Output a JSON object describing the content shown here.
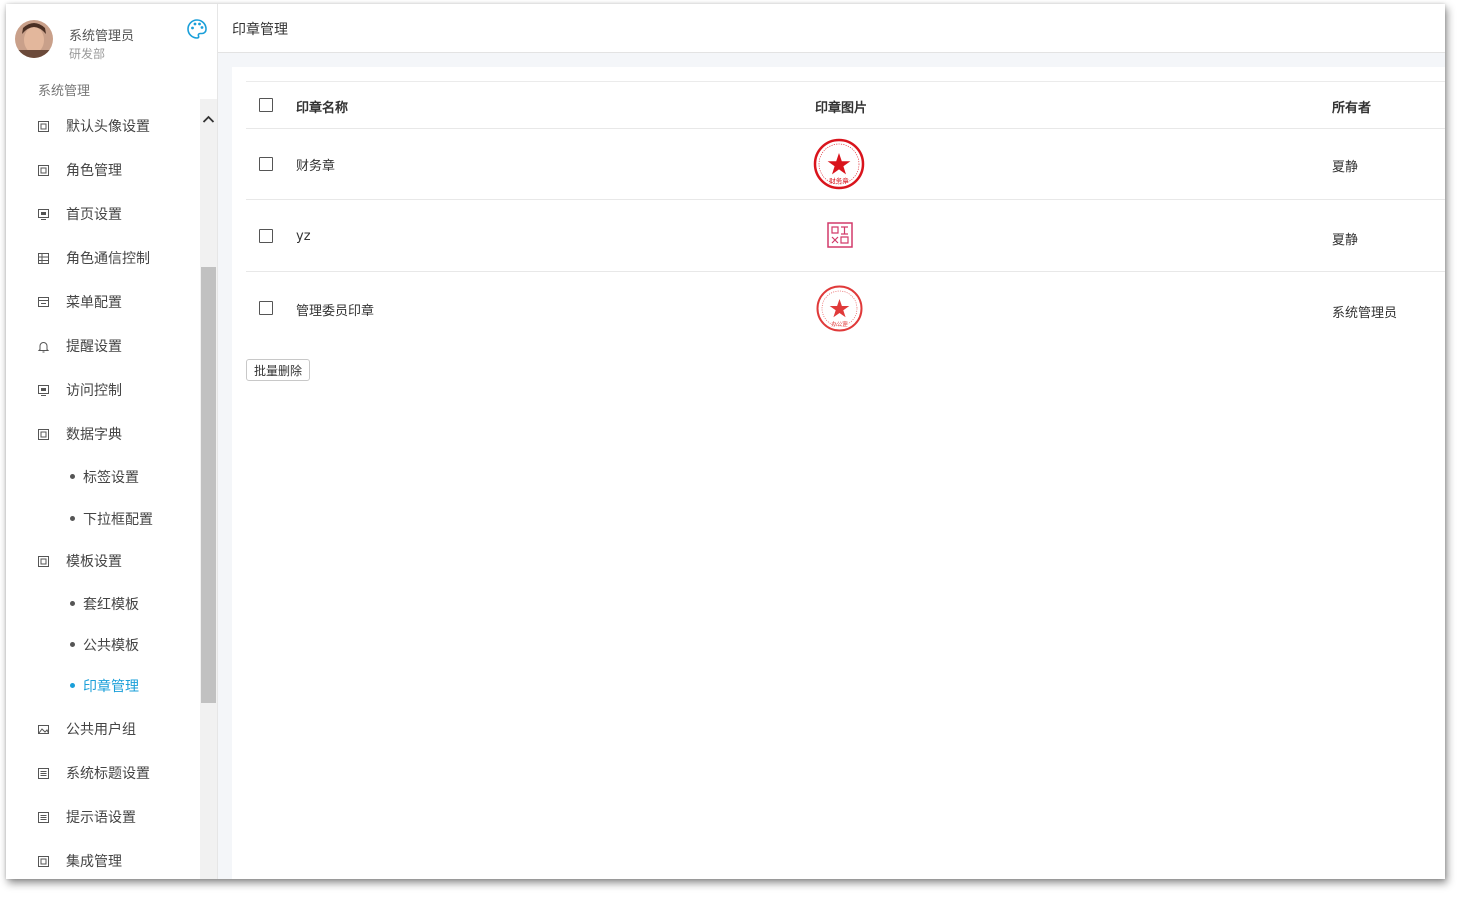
{
  "user": {
    "name": "系统管理员",
    "dept": "研发部"
  },
  "sidebar": {
    "section_title": "系统管理",
    "items": [
      {
        "label": "默认头像设置",
        "icon": "grid-icon"
      },
      {
        "label": "角色管理",
        "icon": "grid-icon"
      },
      {
        "label": "首页设置",
        "icon": "monitor-icon"
      },
      {
        "label": "角色通信控制",
        "icon": "table-icon"
      },
      {
        "label": "菜单配置",
        "icon": "window-icon"
      },
      {
        "label": "提醒设置",
        "icon": "bell-icon"
      },
      {
        "label": "访问控制",
        "icon": "monitor-icon"
      },
      {
        "label": "数据字典",
        "icon": "grid-icon"
      },
      {
        "label": "标签设置",
        "sub": true
      },
      {
        "label": "下拉框配置",
        "sub": true
      },
      {
        "label": "模板设置",
        "icon": "grid-icon"
      },
      {
        "label": "套红模板",
        "sub": true
      },
      {
        "label": "公共模板",
        "sub": true
      },
      {
        "label": "印章管理",
        "sub": true,
        "active": true
      },
      {
        "label": "公共用户组",
        "icon": "image-icon"
      },
      {
        "label": "系统标题设置",
        "icon": "list-icon"
      },
      {
        "label": "提示语设置",
        "icon": "list-icon"
      },
      {
        "label": "集成管理",
        "icon": "grid-icon"
      }
    ]
  },
  "page": {
    "title": "印章管理"
  },
  "table": {
    "columns": [
      "印章名称",
      "印章图片",
      "所有者"
    ],
    "rows": [
      {
        "name": "财务章",
        "stamp": "finance-seal",
        "stamp_text": "财务章",
        "owner": "夏静"
      },
      {
        "name": "yz",
        "stamp": "square-seal",
        "owner": "夏静"
      },
      {
        "name": "管理委员印章",
        "stamp": "committee-seal",
        "stamp_text": "办公室",
        "owner": "系统管理员"
      }
    ]
  },
  "actions": {
    "batch_delete": "批量删除"
  },
  "colors": {
    "accent": "#1a9fd9",
    "seal_red": "#d9141c"
  }
}
